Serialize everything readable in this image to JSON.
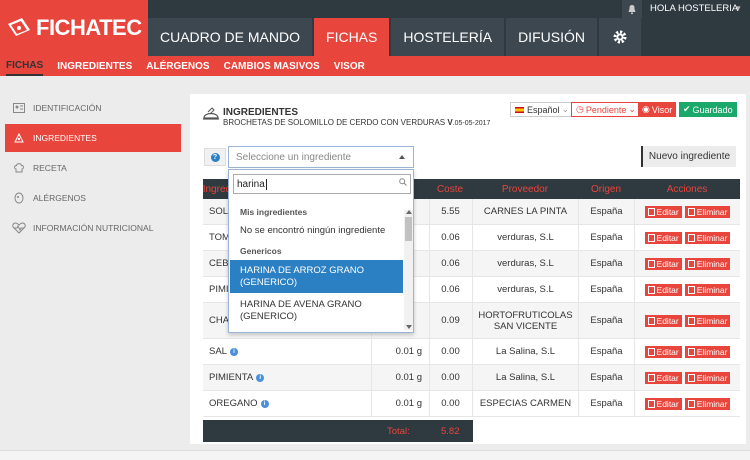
{
  "app": {
    "logo_a": "FICHA",
    "logo_b": "TEC",
    "user": "HOLA HOSTELERIA"
  },
  "colors": {
    "brand": "#e8453c",
    "dark": "#2f3940",
    "green": "#1aa86b",
    "blue": "#2b7fc3"
  },
  "topnav": [
    "CUADRO DE MANDO",
    "FICHAS",
    "HOSTELERÍA",
    "DIFUSIÓN"
  ],
  "subnav": [
    "FICHAS",
    "INGREDIENTES",
    "ALÉRGENOS",
    "CAMBIOS MASIVOS",
    "VISOR"
  ],
  "sidebar": [
    {
      "label": "IDENTIFICACIÓN",
      "icon": "id-card-icon"
    },
    {
      "label": "INGREDIENTES",
      "icon": "ingredients-icon"
    },
    {
      "label": "RECETA",
      "icon": "chef-hat-icon"
    },
    {
      "label": "ALÉRGENOS",
      "icon": "allergen-icon"
    },
    {
      "label": "INFORMACIÓN NUTRICIONAL",
      "icon": "heart-pulse-icon"
    }
  ],
  "header": {
    "title": "INGREDIENTES",
    "subtitle": "BROCHETAS DE SOLOMILLO DE CERDO CON VERDURAS",
    "version_prefix": "V",
    "version": ".05-05-2017",
    "lang": "Español",
    "status": "Pendiente",
    "visor": "Visor",
    "saved": "Guardado"
  },
  "select": {
    "placeholder": "Seleccione un ingrediente"
  },
  "nuevo": "Nuevo ingrediente",
  "table": {
    "headers": [
      "Ingredi",
      "Coste",
      "Proveedor",
      "Origen",
      "Acciones"
    ],
    "edit": "Editar",
    "delete": "Eliminar",
    "rows": [
      {
        "name": "SOLO",
        "qty": "",
        "cost": "5.55",
        "prov": "CARNES LA PINTA",
        "orig": "España",
        "info": false
      },
      {
        "name": "TOM",
        "qty": "",
        "cost": "0.06",
        "prov": "verduras, S.L",
        "orig": "España",
        "info": false
      },
      {
        "name": "CEBO",
        "qty": "",
        "cost": "0.06",
        "prov": "verduras, S.L",
        "orig": "España",
        "info": false
      },
      {
        "name": "PIMI",
        "qty": "",
        "cost": "0.06",
        "prov": "verduras, S.L",
        "orig": "España",
        "info": false
      },
      {
        "name": "CHA",
        "qty": "",
        "cost": "0.09",
        "prov": "HORTOFRUTICOLAS SAN VICENTE",
        "orig": "España",
        "info": false
      },
      {
        "name": "SAL",
        "qty": "0.01 g",
        "cost": "0.00",
        "prov": "La Salina, S.L",
        "orig": "España",
        "info": true
      },
      {
        "name": "PIMIENTA",
        "qty": "0.01 g",
        "cost": "0.00",
        "prov": "La Salina, S.L",
        "orig": "España",
        "info": true
      },
      {
        "name": "OREGANO",
        "qty": "0.01 g",
        "cost": "0.00",
        "prov": "ESPECIAS CARMEN",
        "orig": "España",
        "info": true
      }
    ],
    "total_label": "Total:",
    "total_value": "5.82"
  },
  "dropdown": {
    "search_value": "harina",
    "group1": "Mis ingredientes",
    "no_result": "No se encontró ningún ingrediente",
    "group2": "Genericos",
    "options": [
      "HARINA DE ARROZ GRANO (GENERICO)",
      "HARINA DE AVENA GRANO (GENERICO)"
    ]
  }
}
